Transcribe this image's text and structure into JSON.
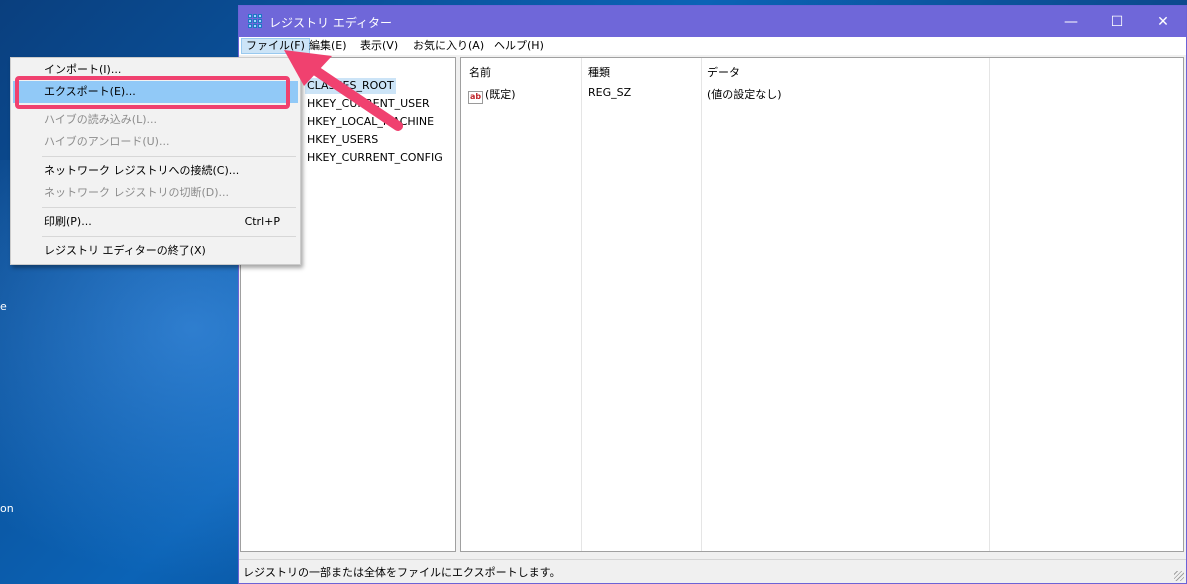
{
  "window": {
    "title": "レジストリ エディター",
    "controls": {
      "minimize": "—",
      "maximize": "☐",
      "close": "✕"
    }
  },
  "menubar": {
    "items": [
      {
        "label": "ファイル(F)"
      },
      {
        "label": "編集(E)"
      },
      {
        "label": "表示(V)"
      },
      {
        "label": "お気に入り(A)"
      },
      {
        "label": "ヘルプ(H)"
      }
    ]
  },
  "tree": {
    "items": [
      {
        "label": "CLASSES_ROOT"
      },
      {
        "label": "HKEY_CURRENT_USER"
      },
      {
        "label": "HKEY_LOCAL_MACHINE"
      },
      {
        "label": "HKEY_USERS"
      },
      {
        "label": "HKEY_CURRENT_CONFIG"
      }
    ]
  },
  "list": {
    "columns": {
      "name": "名前",
      "type": "種類",
      "data": "データ"
    },
    "rows": [
      {
        "name": "(既定)",
        "type": "REG_SZ",
        "data": "(値の設定なし)"
      }
    ],
    "value_icon": "ab"
  },
  "file_menu": {
    "items": [
      {
        "label": "インポート(I)..."
      },
      {
        "label": "エクスポート(E)..."
      },
      {
        "label": "ハイブの読み込み(L)..."
      },
      {
        "label": "ハイブのアンロード(U)..."
      },
      {
        "label": "ネットワーク レジストリへの接続(C)..."
      },
      {
        "label": "ネットワーク レジストリの切断(D)..."
      },
      {
        "label": "印刷(P)...",
        "shortcut": "Ctrl+P"
      },
      {
        "label": "レジストリ エディターの終了(X)"
      }
    ]
  },
  "statusbar": {
    "text": "レジストリの一部または全体をファイルにエクスポートします。"
  },
  "desktop": {
    "fragment_1": "e",
    "fragment_2": "on"
  },
  "colors": {
    "titlebar": "#6f67d9",
    "highlight": "#f0416f",
    "menu_hover": "#91c9f7"
  }
}
